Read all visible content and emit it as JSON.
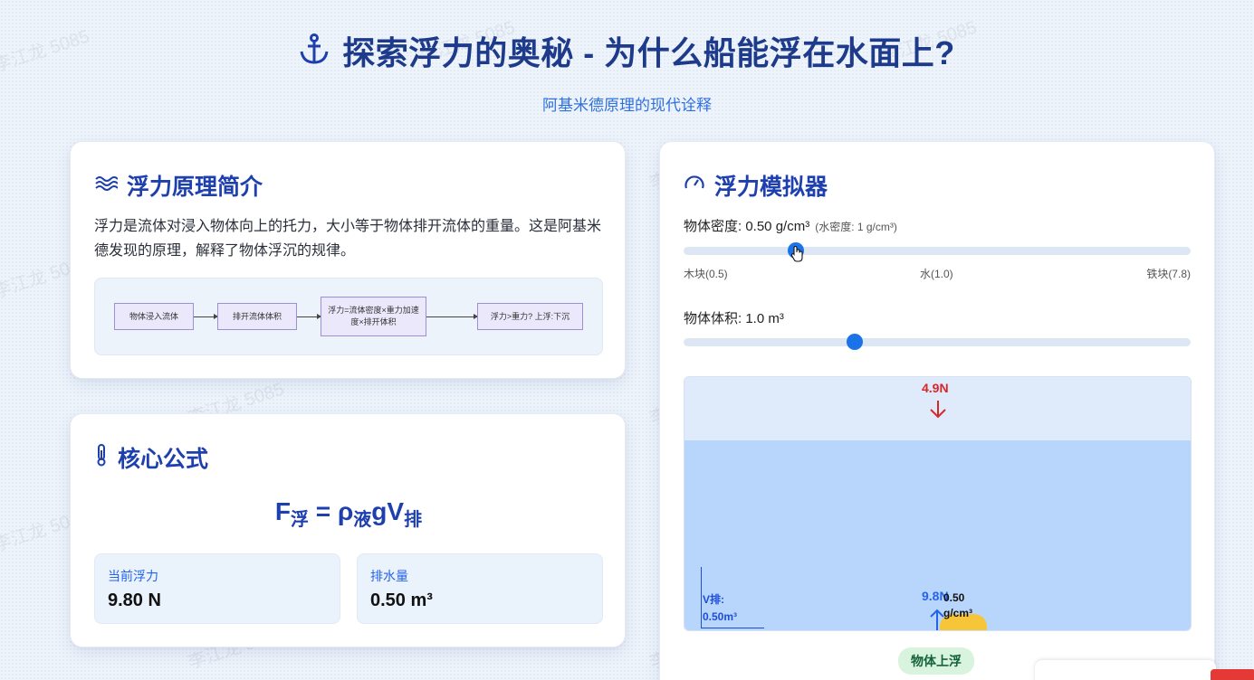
{
  "header": {
    "title": "探索浮力的奥秘 - 为什么船能浮在水面上?",
    "subtitle": "阿基米德原理的现代诠释"
  },
  "intro": {
    "title": "浮力原理简介",
    "description": "浮力是流体对浸入物体向上的托力，大小等于物体排开流体的重量。这是阿基米德发现的原理，解释了物体浮沉的规律。",
    "flow": [
      "物体浸入流体",
      "排开流体体积",
      "浮力=流体密度×重力加速度×排开体积",
      "浮力>重力? 上浮:下沉"
    ]
  },
  "formula": {
    "title": "核心公式",
    "eq_f": "F",
    "eq_f_sub": "浮",
    "eq_eq": " = ",
    "eq_rho": "ρ",
    "eq_rho_sub": "液",
    "eq_g": "gV",
    "eq_v_sub": "排",
    "current_buoyancy_label": "当前浮力",
    "current_buoyancy_value": "9.80 N",
    "displacement_label": "排水量",
    "displacement_value": "0.50 m³"
  },
  "simulator": {
    "title": "浮力模拟器",
    "density_label": "物体密度: 0.50 g/cm³",
    "water_density_note": "(水密度: 1 g/cm³)",
    "density_slider_value": 0.5,
    "tick_min": "木块(0.5)",
    "tick_mid": "水(1.0)",
    "tick_max": "铁块(7.8)",
    "volume_label": "物体体积: 1.0 m³",
    "volume_slider_fraction": 0.34,
    "gravity_force": "4.9N",
    "buoyant_force": "9.8N",
    "v_disp_label": "V排:",
    "v_disp_value": "0.50m³",
    "block_density_value": "0.50",
    "block_density_unit": "g/cm³",
    "status": "物体上浮"
  },
  "watermark": "李江龙 5085",
  "colors": {
    "primary": "#1e40af",
    "accent": "#1a73e8",
    "gravity": "#d62828",
    "block": "#f7c53a",
    "status_bg": "#d8f3de"
  }
}
